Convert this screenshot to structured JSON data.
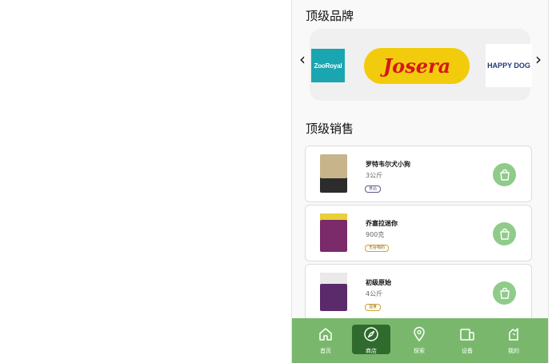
{
  "sections": {
    "brands_title": "顶级品牌",
    "sales_title": "顶级销售"
  },
  "brands": [
    {
      "name": "ZooRoyal",
      "text": "ZooRoyal"
    },
    {
      "name": "Josera",
      "text": "Josera"
    },
    {
      "name": "Happy Dog",
      "text": "HAPPY DOG"
    }
  ],
  "products": [
    {
      "name": "罗特韦尔犬小狗",
      "weight": "3公斤",
      "tag": "食品",
      "tag_color": "#5b5b8a",
      "pack_color": "#c8b48a"
    },
    {
      "name": "乔塞拉迷你",
      "weight": "900克",
      "tag": "无谷物的",
      "tag_color": "#d2a233",
      "pack_color": "#7b2a6a"
    },
    {
      "name": "初级原始",
      "weight": "4公斤",
      "tag": "湿食",
      "tag_color": "#d2a233",
      "pack_color": "#5b2a6a"
    }
  ],
  "nav": [
    {
      "label": "首页",
      "icon": "home-icon"
    },
    {
      "label": "商店",
      "icon": "compass-icon"
    },
    {
      "label": "探索",
      "icon": "location-pin-icon"
    },
    {
      "label": "设备",
      "icon": "devices-icon"
    },
    {
      "label": "我的",
      "icon": "profile-icon"
    }
  ],
  "colors": {
    "accent": "#79b86c",
    "active_nav": "#2e6b2c",
    "cart_button": "#8fcb89"
  }
}
